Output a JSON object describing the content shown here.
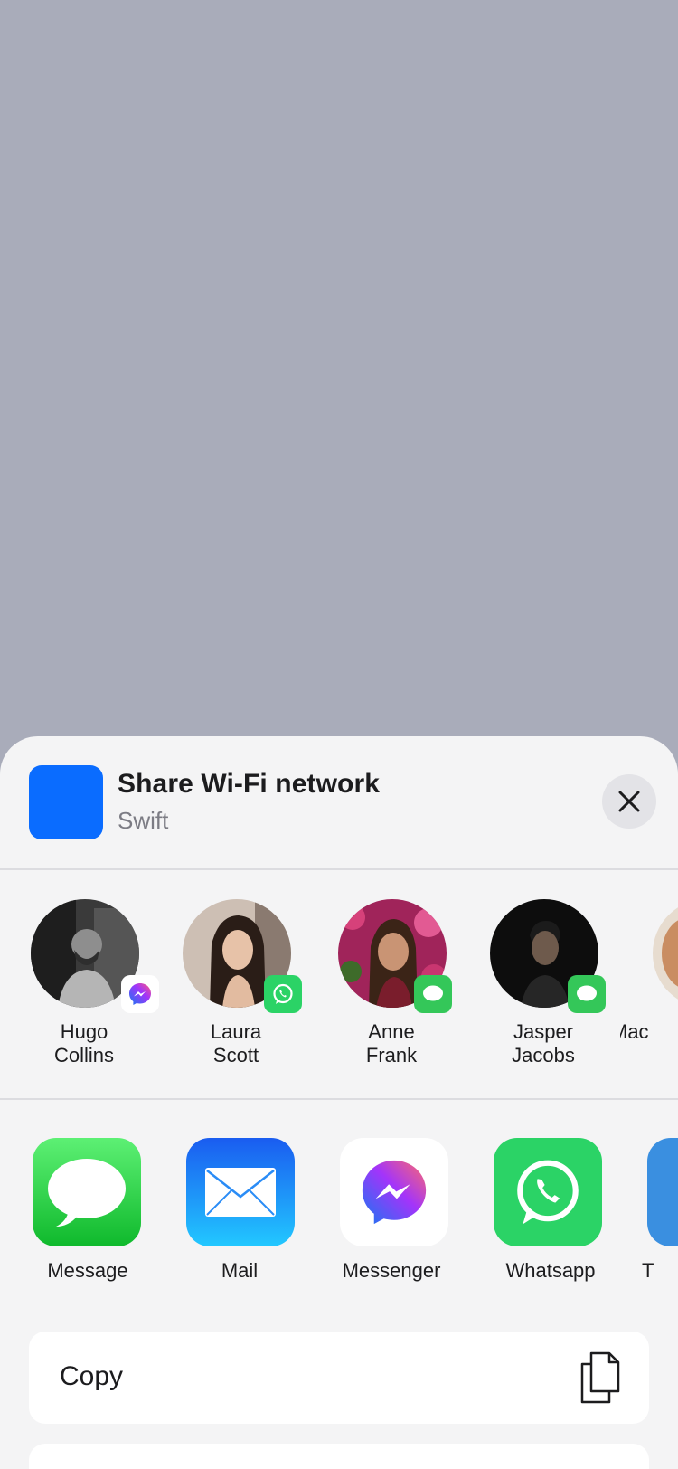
{
  "share_sheet": {
    "title": "Share Wi-Fi network",
    "subtitle": "Swift",
    "close_icon": "xmark-icon",
    "accent_color": "#0a6cff"
  },
  "contacts": [
    {
      "first": "Hugo",
      "last": "Collins",
      "badge": "messenger"
    },
    {
      "first": "Laura",
      "last": "Scott",
      "badge": "whatsapp"
    },
    {
      "first": "Anne",
      "last": "Frank",
      "badge": "message"
    },
    {
      "first": "Jasper",
      "last": "Jacobs",
      "badge": "message"
    },
    {
      "first": "Mac",
      "last": "",
      "badge": ""
    }
  ],
  "apps": [
    {
      "label": "Message",
      "icon": "messages-app-icon"
    },
    {
      "label": "Mail",
      "icon": "mail-app-icon"
    },
    {
      "label": "Messenger",
      "icon": "messenger-app-icon"
    },
    {
      "label": "Whatsapp",
      "icon": "whatsapp-app-icon"
    },
    {
      "label": "T",
      "icon": "twitter-app-icon"
    }
  ],
  "actions": [
    {
      "label": "Copy",
      "icon": "copy-icon"
    }
  ],
  "colors": {
    "backdrop": "#a9acba",
    "sheet": "#f4f4f5",
    "message_green": "#34c759",
    "whatsapp_green": "#2bd366",
    "mail_blue": "#1e88ff"
  }
}
